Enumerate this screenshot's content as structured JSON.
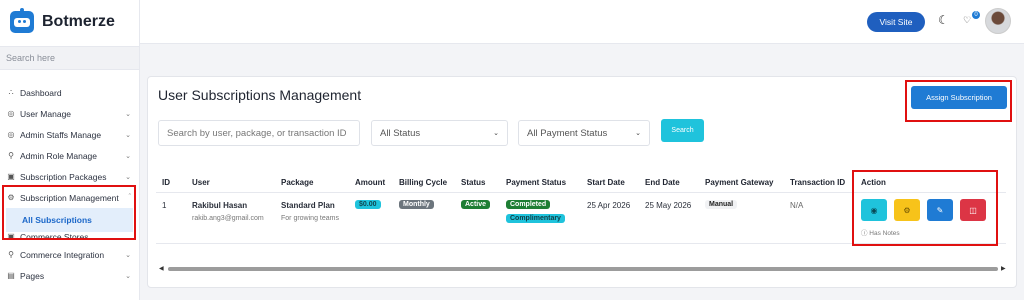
{
  "app": {
    "name": "Botmerze"
  },
  "sidebar": {
    "search_placeholder": "Search here",
    "items": [
      {
        "label": "Dashboard",
        "icon": "dashboard-icon",
        "chevron": false
      },
      {
        "label": "User Manage",
        "icon": "user-icon",
        "chevron": true
      },
      {
        "label": "Admin Staffs Manage",
        "icon": "staff-icon",
        "chevron": true
      },
      {
        "label": "Admin Role Manage",
        "icon": "role-icon",
        "chevron": true
      },
      {
        "label": "Subscription Packages",
        "icon": "package-icon",
        "chevron": true
      },
      {
        "label": "Subscription Management",
        "icon": "subscription-icon",
        "chevron": true,
        "expanded": true
      },
      {
        "label": "Commerce Stores",
        "icon": "store-icon",
        "chevron": false
      },
      {
        "label": "Commerce Integration",
        "icon": "integration-icon",
        "chevron": true
      },
      {
        "label": "Pages",
        "icon": "pages-icon",
        "chevron": true
      }
    ],
    "sub_active": "All Subscriptions"
  },
  "topbar": {
    "visit_site": "Visit Site",
    "notification_count": "0"
  },
  "page": {
    "title": "User Subscriptions Management",
    "assign_button": "Assign Subscription",
    "search_placeholder": "Search by user, package, or transaction ID",
    "status_filter": "All Status",
    "payment_filter": "All Payment Status",
    "search_button": "Search"
  },
  "table": {
    "headers": [
      "ID",
      "User",
      "Package",
      "Amount",
      "Billing Cycle",
      "Status",
      "Payment Status",
      "Start Date",
      "End Date",
      "Payment Gateway",
      "Transaction ID",
      "Action"
    ],
    "rows": [
      {
        "id": "1",
        "user_name": "Rakibul Hasan",
        "user_email": "rakib.ang3@gmail.com",
        "package_name": "Standard Plan",
        "package_desc": "For growing teams",
        "amount": "$0.00",
        "billing_cycle": "Monthly",
        "status": "Active",
        "payment_status": "Completed",
        "payment_note": "Complimentary",
        "start_date": "25 Apr 2026",
        "end_date": "25 May 2026",
        "gateway": "Manual",
        "transaction_id": "N/A",
        "notes": "ⓘ Has Notes"
      }
    ]
  },
  "colors": {
    "primary": "#1f7bd4",
    "info": "#1fc3dc",
    "success": "#1e7e34",
    "warning": "#f7c31a",
    "danger": "#dc3545",
    "highlight": "#e01010"
  }
}
